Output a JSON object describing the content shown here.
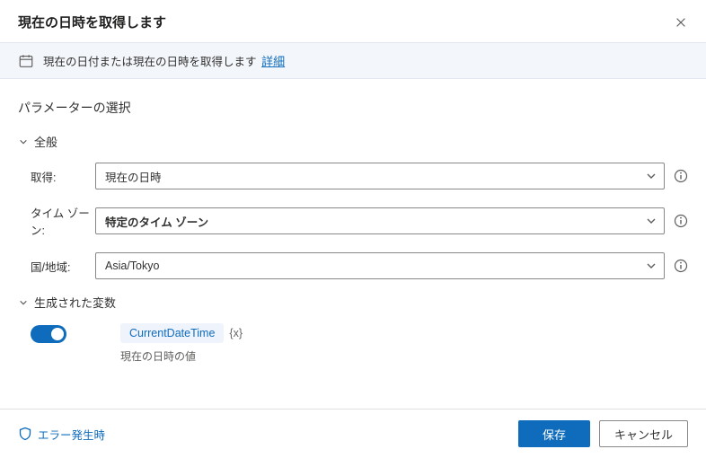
{
  "header": {
    "title": "現在の日時を取得します"
  },
  "info": {
    "text": "現在の日付または現在の日時を取得します",
    "link": "詳細"
  },
  "section": {
    "title": "パラメーターの選択"
  },
  "groups": {
    "general": "全般",
    "vars": "生成された変数"
  },
  "fields": {
    "retrieve": {
      "label": "取得:",
      "value": "現在の日時"
    },
    "timezone": {
      "label": "タイム ゾーン:",
      "value": "特定のタイム ゾーン"
    },
    "country": {
      "label": "国/地域:",
      "value": "Asia/Tokyo"
    }
  },
  "variable": {
    "name": "CurrentDateTime",
    "type": "{x}",
    "desc": "現在の日時の値"
  },
  "footer": {
    "onError": "エラー発生時",
    "save": "保存",
    "cancel": "キャンセル"
  }
}
